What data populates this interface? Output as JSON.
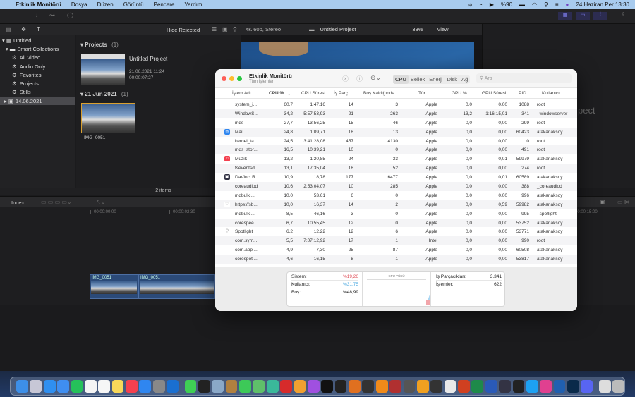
{
  "menubar": {
    "app": "Etkinlik Monitörü",
    "items": [
      "Dosya",
      "Düzen",
      "Görüntü",
      "Pencere",
      "Yardım"
    ],
    "battery": "%90",
    "clock": "24 Haziran Per  13:30"
  },
  "fcp": {
    "hide_rejected": "Hide Rejected",
    "library": "Untitled",
    "smart_collections": "Smart Collections",
    "collections": [
      "All Video",
      "Audio Only",
      "Favorites",
      "Projects",
      "Stills"
    ],
    "event": "14.06.2021",
    "projects_header": "Projects",
    "projects_count": "(1)",
    "project_name": "Untitled Project",
    "project_date": "21.06.2021 11:24",
    "project_duration": "00:00:07:27",
    "date_header": "21 Jun 2021",
    "date_count": "(1)",
    "clip_name": "IMG_0051",
    "items": "2 items",
    "viewer_format": "4K 60p, Stereo",
    "viewer_title": "Untitled Project",
    "zoom": "33%",
    "view": "View",
    "viewer_overlay": "pect",
    "index": "Index",
    "timecodes": [
      "00:00:00:00",
      "00:00:02:30",
      "00:00:15:00"
    ],
    "timeline_clips": [
      "IMG_0051",
      "IMG_0051"
    ]
  },
  "am": {
    "title": "Etkinlik Monitörü",
    "subtitle": "Tüm İşlemler",
    "tabs": [
      "CPU",
      "Bellek",
      "Enerji",
      "Disk",
      "Ağ"
    ],
    "active_tab": "CPU",
    "search_placeholder": "Ara",
    "columns": [
      "İşlem Adı",
      "CPU %",
      "CPU Süresi",
      "İş Parç...",
      "Boş Kaldığında...",
      "Tür",
      "GPU %",
      "GPU Süresi",
      "PID",
      "Kullanıcı"
    ],
    "rows": [
      [
        "system_i...",
        "60,7",
        "1:47,16",
        "14",
        "3",
        "Apple",
        "0,0",
        "0,00",
        "1088",
        "root",
        ""
      ],
      [
        "WindowS...",
        "34,2",
        "5:57:53,93",
        "21",
        "263",
        "Apple",
        "13,2",
        "1:16:15,01",
        "341",
        "_windowserver",
        ""
      ],
      [
        "mds",
        "27,7",
        "13:56,25",
        "15",
        "46",
        "Apple",
        "0,0",
        "0,00",
        "299",
        "root",
        ""
      ],
      [
        "Mail",
        "24,8",
        "1:09,71",
        "18",
        "13",
        "Apple",
        "0,0",
        "0,00",
        "60423",
        "atakanaksoy",
        "mail"
      ],
      [
        "kernel_ta...",
        "24,5",
        "3:41:28,08",
        "457",
        "4130",
        "Apple",
        "0,0",
        "0,00",
        "0",
        "root",
        ""
      ],
      [
        "mds_stor...",
        "16,5",
        "10:39,21",
        "10",
        "0",
        "Apple",
        "0,0",
        "0,00",
        "491",
        "root",
        ""
      ],
      [
        "Müzik",
        "13,2",
        "1:20,85",
        "24",
        "33",
        "Apple",
        "0,0",
        "0,01",
        "59979",
        "atakanaksoy",
        "music"
      ],
      [
        "fseventsd",
        "13,1",
        "17:35,04",
        "18",
        "52",
        "Apple",
        "0,0",
        "0,00",
        "274",
        "root",
        ""
      ],
      [
        "DaVinci R...",
        "10,9",
        "18,78",
        "177",
        "6477",
        "Apple",
        "0,0",
        "0,01",
        "60589",
        "atakanaksoy",
        "davinci"
      ],
      [
        "coreaudiod",
        "10,6",
        "2:53:04,07",
        "10",
        "285",
        "Apple",
        "0,0",
        "0,00",
        "388",
        "_coreaudiod",
        ""
      ],
      [
        "mdbulki...",
        "10,0",
        "53,61",
        "6",
        "0",
        "Apple",
        "0,0",
        "0,00",
        "996",
        "atakanaksoy",
        ""
      ],
      [
        "https://sb...",
        "10,0",
        "16,37",
        "14",
        "2",
        "Apple",
        "0,0",
        "0,59",
        "59982",
        "atakanaksoy",
        "shield"
      ],
      [
        "mdbulki...",
        "8,5",
        "46,16",
        "3",
        "0",
        "Apple",
        "0,0",
        "0,00",
        "995",
        "_spotlight",
        ""
      ],
      [
        "corespee...",
        "6,7",
        "10:55,45",
        "12",
        "0",
        "Apple",
        "0,0",
        "0,00",
        "53752",
        "atakanaksoy",
        ""
      ],
      [
        "Spotlight",
        "6,2",
        "12,22",
        "12",
        "6",
        "Apple",
        "0,0",
        "0,00",
        "53771",
        "atakanaksoy",
        "spotlight"
      ],
      [
        "com.sym...",
        "5,5",
        "7:07:12,92",
        "17",
        "1",
        "Intel",
        "0,0",
        "0,00",
        "990",
        "root",
        ""
      ],
      [
        "com.appl...",
        "4,9",
        "7,30",
        "25",
        "87",
        "Apple",
        "0,0",
        "0,00",
        "60508",
        "atakanaksoy",
        ""
      ],
      [
        "corespotl...",
        "4,6",
        "16,15",
        "8",
        "1",
        "Apple",
        "0,0",
        "0,00",
        "53817",
        "atakanaksoy",
        ""
      ]
    ],
    "stats": {
      "system_label": "Sistem:",
      "system": "%19,26",
      "user_label": "Kullanıcı:",
      "user": "%31,75",
      "idle_label": "Boş:",
      "idle": "%48,99",
      "load_title": "CPU YÜKÜ",
      "threads_label": "İş Parçacıkları:",
      "threads": "3.341",
      "processes_label": "İşlemler:",
      "processes": "622",
      "system_color": "#e0505a",
      "user_color": "#4aa8e0"
    }
  },
  "dock": {
    "icons": [
      [
        "finder",
        "#3d8fe8"
      ],
      [
        "launchpad",
        "#c7c7d6"
      ],
      [
        "safari",
        "#2f8ff0"
      ],
      [
        "mail",
        "#3f8ef0"
      ],
      [
        "whatsapp",
        "#25c15a"
      ],
      [
        "calendar",
        "#f4f4f4"
      ],
      [
        "reminders",
        "#f6f6f6"
      ],
      [
        "notes",
        "#f7d85a"
      ],
      [
        "music",
        "#f4404f"
      ],
      [
        "app-store",
        "#2f86f0"
      ],
      [
        "system-preferences",
        "#888"
      ],
      [
        "outlook",
        "#1a6fd0"
      ],
      [
        "messages",
        "#3fcf55"
      ],
      [
        "activity-monitor",
        "#222"
      ],
      [
        "preview",
        "#8aa8c8"
      ],
      [
        "keynote-like",
        "#b08040"
      ],
      [
        "facetime",
        "#3dc958"
      ],
      [
        "maps",
        "#5fbf6a"
      ],
      [
        "find-my",
        "#3ab89a"
      ],
      [
        "pdf-app",
        "#d62b2b"
      ],
      [
        "photos",
        "#f0a030"
      ],
      [
        "podcasts",
        "#a050e0"
      ],
      [
        "apple-tv",
        "#111"
      ],
      [
        "voice-memos",
        "#222"
      ],
      [
        "garageband",
        "#e07020"
      ],
      [
        "logic",
        "#333"
      ],
      [
        "books",
        "#f08a1a"
      ],
      [
        "dictionary",
        "#b03030"
      ],
      [
        "calculator",
        "#555"
      ],
      [
        "pages",
        "#f0a020"
      ],
      [
        "final-cut",
        "#333"
      ],
      [
        "chrome",
        "#e8e8e8"
      ],
      [
        "powerpoint",
        "#d04020"
      ],
      [
        "excel",
        "#1e8a4a"
      ],
      [
        "word",
        "#2a5ab8"
      ],
      [
        "davinci",
        "#334"
      ],
      [
        "photoshop-like",
        "#222"
      ],
      [
        "twitter",
        "#1da1f2"
      ],
      [
        "claquette",
        "#e04090"
      ],
      [
        "pen-app",
        "#2060b0"
      ],
      [
        "lightroom",
        "#0a2a4a"
      ],
      [
        "discord",
        "#5865f2"
      ],
      [
        "downloads",
        "#ddd"
      ],
      [
        "trash",
        "#bbb"
      ]
    ]
  }
}
